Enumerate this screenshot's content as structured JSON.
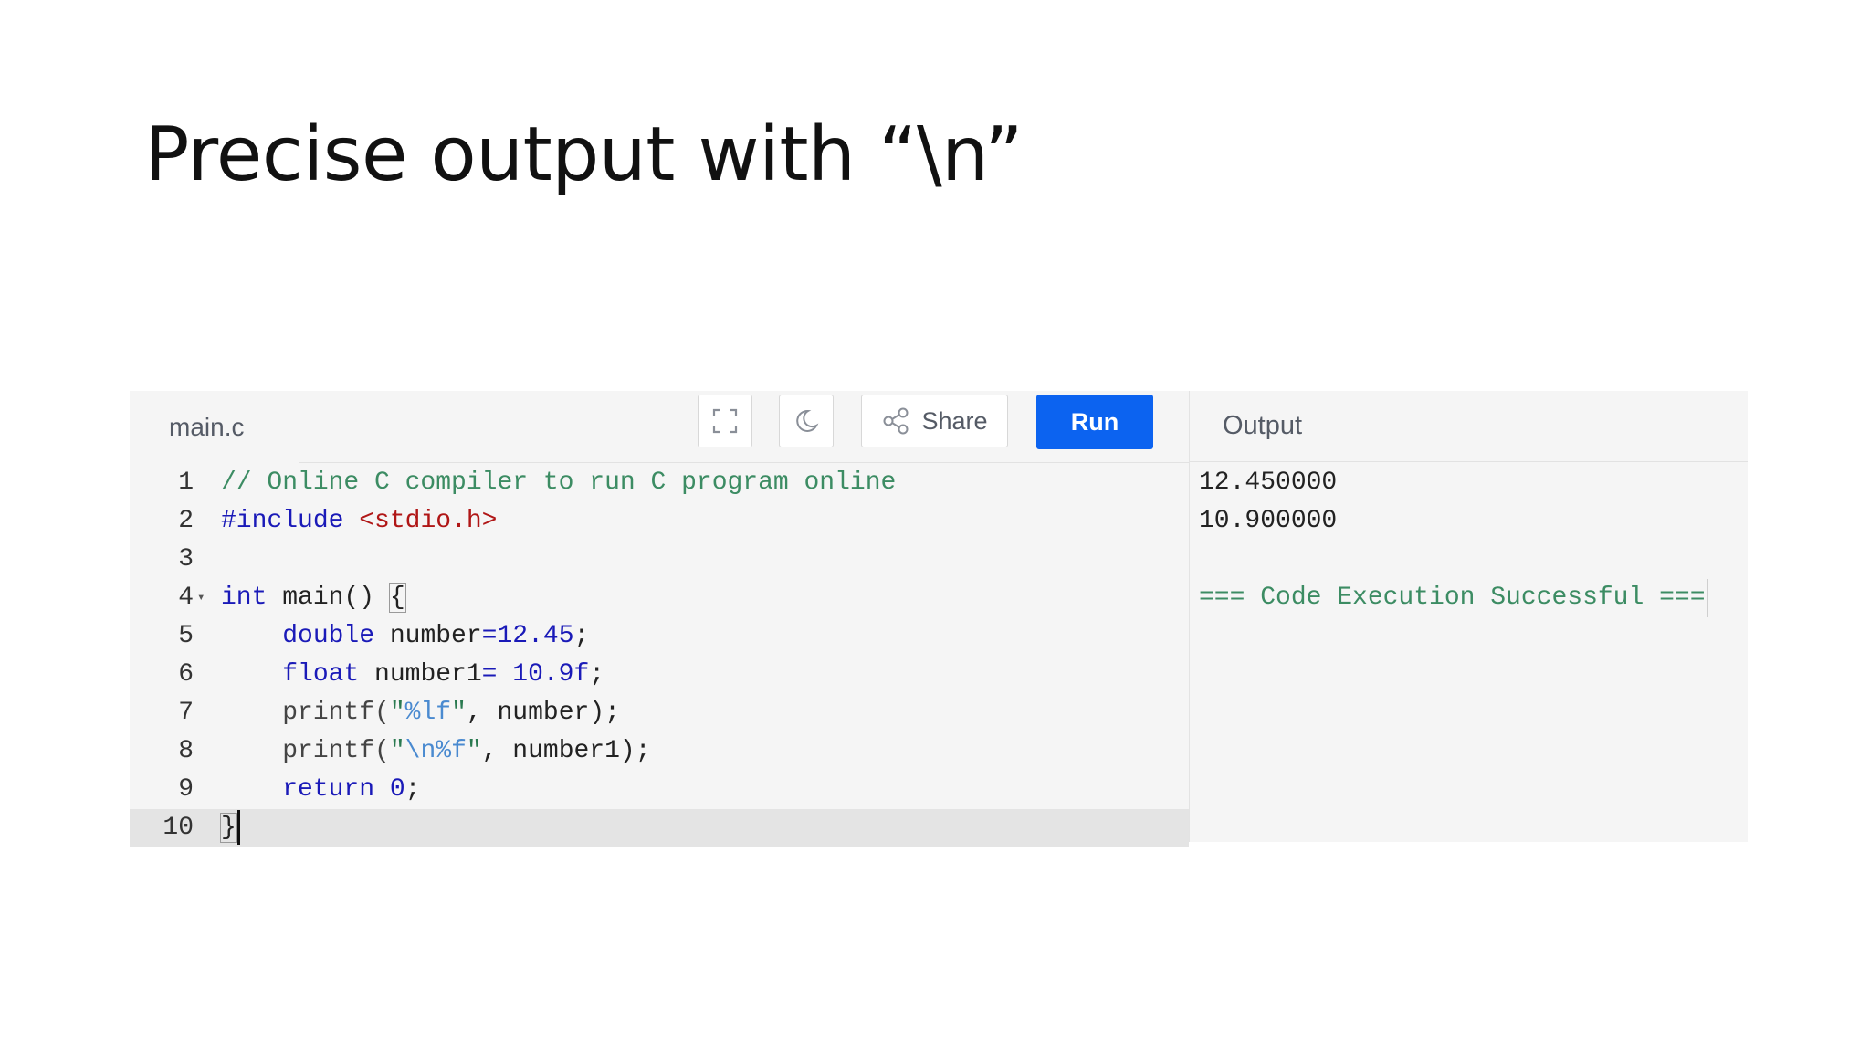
{
  "slide": {
    "title": "Precise output with “\\n”"
  },
  "editor": {
    "file_tab": "main.c",
    "toolbar": {
      "fullscreen_icon": "fullscreen-icon",
      "theme_icon": "moon-icon",
      "share_icon": "share-icon",
      "share_label": "Share",
      "run_label": "Run"
    },
    "line_numbers": [
      "1",
      "2",
      "3",
      "4",
      "5",
      "6",
      "7",
      "8",
      "9",
      "10"
    ],
    "lines": {
      "l1": {
        "comment": "// Online C compiler to run C program online"
      },
      "l2": {
        "directive": "#include",
        "header": "<stdio.h>"
      },
      "l4": {
        "kw": "int",
        "rest": " main() ",
        "brace": "{"
      },
      "l5": {
        "indent": "    ",
        "kw": "double",
        "name": " number",
        "op": "=",
        "num": "12.45",
        "end": ";"
      },
      "l6": {
        "indent": "    ",
        "kw": "float",
        "name": " number1",
        "op": "= ",
        "num": "10.9f",
        "end": ";"
      },
      "l7": {
        "indent": "    ",
        "fn": "printf(",
        "q1": "\"",
        "fmt": "%lf",
        "q2": "\"",
        "rest": ", number);"
      },
      "l8": {
        "indent": "    ",
        "fn": "printf(",
        "q1": "\"",
        "fmt": "\\n%f",
        "q2": "\"",
        "rest": ", number1);"
      },
      "l9": {
        "indent": "    ",
        "kw": "return",
        "sp": " ",
        "num": "0",
        "end": ";"
      },
      "l10": {
        "brace": "}"
      }
    },
    "active_line": 10
  },
  "output": {
    "title": "Output",
    "lines": [
      "12.450000",
      "10.900000",
      "",
      "=== Code Execution Successful ==="
    ]
  }
}
